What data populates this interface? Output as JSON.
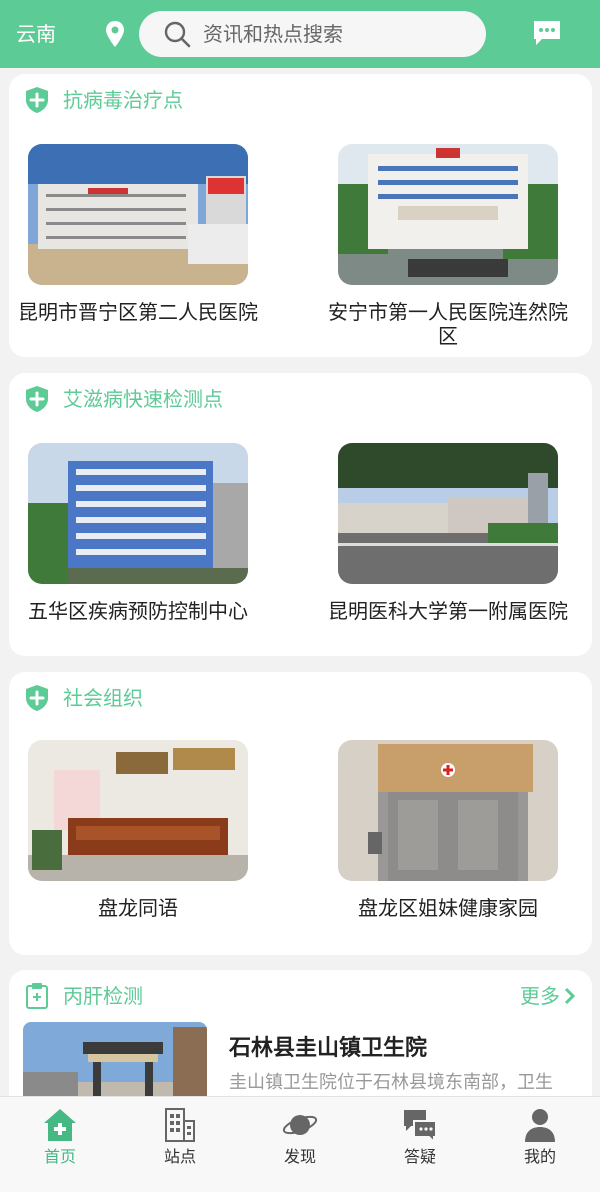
{
  "header": {
    "region": "云南",
    "search_placeholder": "资讯和热点搜索",
    "icons": [
      "location-pin-icon",
      "search-icon",
      "message-icon"
    ],
    "color": "#5dcb95"
  },
  "sections": [
    {
      "title": "抗病毒治疗点",
      "items": [
        {
          "label": "昆明市晋宁区第二人民医院"
        },
        {
          "label": "安宁市第一人民医院连然院区"
        }
      ]
    },
    {
      "title": "艾滋病快速检测点",
      "items": [
        {
          "label": "五华区疾病预防控制中心"
        },
        {
          "label": "昆明医科大学第一附属医院"
        }
      ]
    },
    {
      "title": "社会组织",
      "items": [
        {
          "label": "盘龙同语"
        },
        {
          "label": "盘龙区姐妹健康家园"
        }
      ]
    }
  ],
  "hep_c": {
    "title": "丙肝检测",
    "more": "更多",
    "item": {
      "title": "石林县圭山镇卫生院",
      "desc": "圭山镇卫生院位于石林县境东南部，卫生"
    }
  },
  "tabbar": [
    {
      "label": "首页",
      "icon": "home-icon",
      "active": true
    },
    {
      "label": "站点",
      "icon": "building-icon",
      "active": false
    },
    {
      "label": "发现",
      "icon": "planet-icon",
      "active": false
    },
    {
      "label": "答疑",
      "icon": "chat-icon",
      "active": false
    },
    {
      "label": "我的",
      "icon": "user-icon",
      "active": false
    }
  ]
}
